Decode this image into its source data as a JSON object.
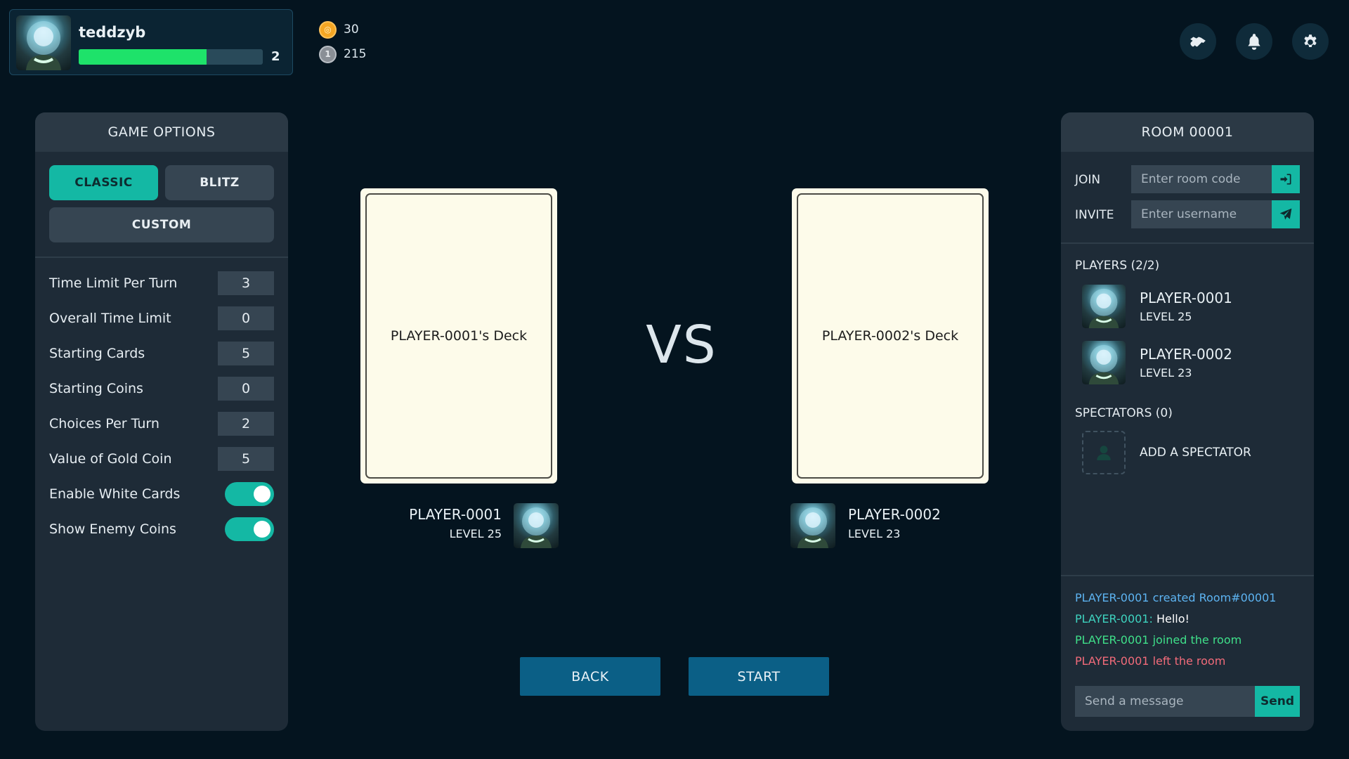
{
  "profile": {
    "username": "teddzyb",
    "level": "2",
    "xp_fraction": 0.695,
    "avatar_icon": "alien-avatar-icon"
  },
  "currency": {
    "gold": "30",
    "gold_icon_glyph": "◎",
    "silver": "215",
    "silver_icon_glyph": "1"
  },
  "top_icons": [
    "handshake-icon",
    "bell-icon",
    "gear-icon"
  ],
  "game_options": {
    "title": "GAME OPTIONS",
    "modes": {
      "classic": "CLASSIC",
      "blitz": "BLITZ",
      "custom": "CUSTOM",
      "active": "classic"
    },
    "settings": [
      {
        "label": "Time Limit Per Turn",
        "value": "3"
      },
      {
        "label": "Overall Time Limit",
        "value": "0"
      },
      {
        "label": "Starting Cards",
        "value": "5"
      },
      {
        "label": "Starting Coins",
        "value": "0"
      },
      {
        "label": "Choices Per Turn",
        "value": "2"
      },
      {
        "label": "Value of Gold Coin",
        "value": "5"
      }
    ],
    "toggles": [
      {
        "label": "Enable White Cards",
        "on": true
      },
      {
        "label": "Show Enemy Coins",
        "on": true
      }
    ]
  },
  "match": {
    "vs": "VS",
    "player1": {
      "deck": "PLAYER-0001's Deck",
      "name": "PLAYER-0001",
      "level": "LEVEL 25"
    },
    "player2": {
      "deck": "PLAYER-0002's Deck",
      "name": "PLAYER-0002",
      "level": "LEVEL 23"
    },
    "back_label": "BACK",
    "start_label": "START"
  },
  "room": {
    "title": "ROOM 00001",
    "join_label": "JOIN",
    "join_placeholder": "Enter room code",
    "invite_label": "INVITE",
    "invite_placeholder": "Enter username",
    "players_title": "PLAYERS (2/2)",
    "players": [
      {
        "name": "PLAYER-0001",
        "level": "LEVEL 25"
      },
      {
        "name": "PLAYER-0002",
        "level": "LEVEL 23"
      }
    ],
    "spectators_title": "SPECTATORS (0)",
    "add_spectator_label": "ADD A SPECTATOR",
    "chat": [
      {
        "text": "PLAYER-0001 created Room#00001",
        "color": "#5db4f2"
      },
      {
        "speaker": "PLAYER-0001:",
        "speaker_color": "#3ed4c0",
        "text": " Hello!",
        "color": "#ffffff"
      },
      {
        "text": "PLAYER-0001 joined the room",
        "color": "#3fe08a"
      },
      {
        "text": "PLAYER-0001 left the room",
        "color": "#f26b7a"
      }
    ],
    "chat_placeholder": "Send a message",
    "send_label": "Send"
  },
  "colors": {
    "accent": "#14b8a4",
    "primary_button": "#0b5f86",
    "background": "#04141f",
    "panel": "#1e2b37",
    "xp_bar": "#1ee26a"
  }
}
